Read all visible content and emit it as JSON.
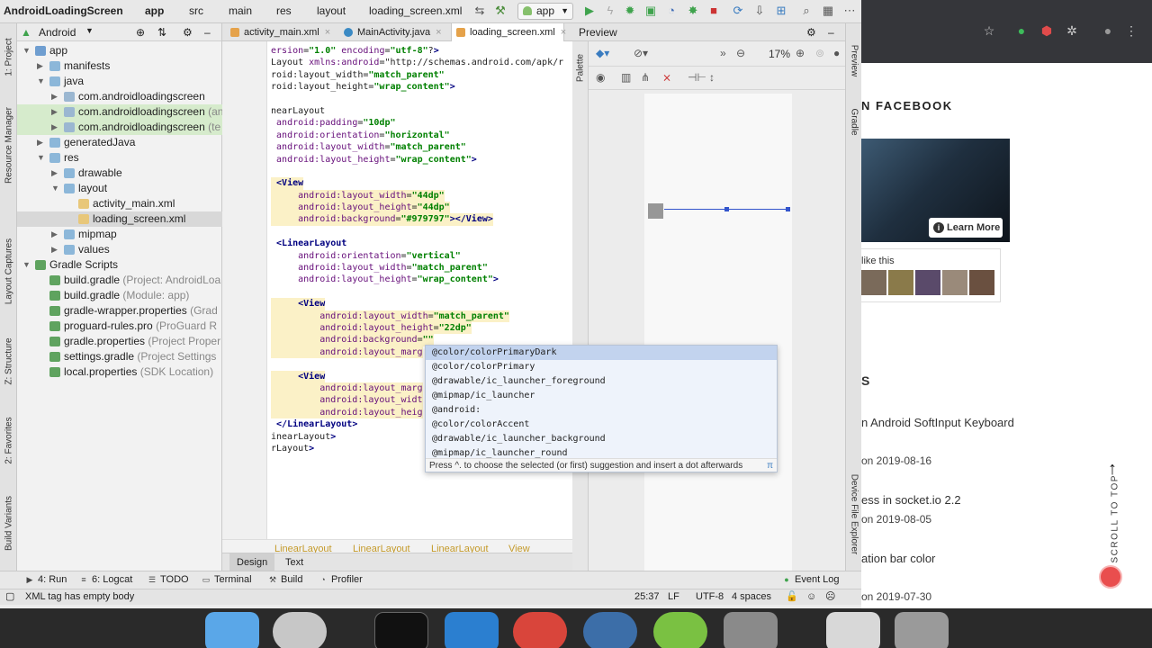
{
  "ide": {
    "breadcrumbs": [
      "AndroidLoadingScreen",
      "app",
      "src",
      "main",
      "res",
      "layout",
      "loading_screen.xml"
    ],
    "run_config": "app",
    "project_view": "Android",
    "editor_tabs": [
      {
        "label": "activity_main.xml",
        "active": false
      },
      {
        "label": "MainActivity.java",
        "active": false
      },
      {
        "label": "loading_screen.xml",
        "active": true
      }
    ],
    "left_strip": [
      "1: Project",
      "Resource Manager",
      "Layout Captures",
      "Z: Structure",
      "2: Favorites",
      "Build Variants"
    ],
    "right_strip": [
      "Preview",
      "Gradle",
      "Device File Explorer"
    ],
    "palette_label": "Palette",
    "tree": [
      {
        "label": "app",
        "extra": "",
        "icon": "module",
        "depth": 0,
        "expanded": true,
        "style": ""
      },
      {
        "label": "manifests",
        "extra": "",
        "icon": "folder",
        "depth": 1,
        "expanded": false,
        "style": ""
      },
      {
        "label": "java",
        "extra": "",
        "icon": "folder",
        "depth": 1,
        "expanded": true,
        "style": ""
      },
      {
        "label": "com.androidloadingscreen",
        "extra": "",
        "icon": "pkg",
        "depth": 2,
        "expanded": false,
        "style": ""
      },
      {
        "label": "com.androidloadingscreen",
        "extra": "(an",
        "icon": "pkg",
        "depth": 2,
        "expanded": false,
        "style": "green"
      },
      {
        "label": "com.androidloadingscreen",
        "extra": "(te",
        "icon": "pkg",
        "depth": 2,
        "expanded": false,
        "style": "green"
      },
      {
        "label": "generatedJava",
        "extra": "",
        "icon": "folder",
        "depth": 1,
        "expanded": false,
        "style": ""
      },
      {
        "label": "res",
        "extra": "",
        "icon": "folder",
        "depth": 1,
        "expanded": true,
        "style": ""
      },
      {
        "label": "drawable",
        "extra": "",
        "icon": "folder",
        "depth": 2,
        "expanded": false,
        "style": ""
      },
      {
        "label": "layout",
        "extra": "",
        "icon": "folder",
        "depth": 2,
        "expanded": true,
        "style": ""
      },
      {
        "label": "activity_main.xml",
        "extra": "",
        "icon": "file",
        "depth": 3,
        "expanded": null,
        "style": ""
      },
      {
        "label": "loading_screen.xml",
        "extra": "",
        "icon": "file",
        "depth": 3,
        "expanded": null,
        "style": "sel"
      },
      {
        "label": "mipmap",
        "extra": "",
        "icon": "folder",
        "depth": 2,
        "expanded": false,
        "style": ""
      },
      {
        "label": "values",
        "extra": "",
        "icon": "folder",
        "depth": 2,
        "expanded": false,
        "style": ""
      },
      {
        "label": "Gradle Scripts",
        "extra": "",
        "icon": "gradle",
        "depth": 0,
        "expanded": true,
        "style": ""
      },
      {
        "label": "build.gradle",
        "extra": "(Project: AndroidLoa",
        "icon": "gradle",
        "depth": 1,
        "expanded": null,
        "style": ""
      },
      {
        "label": "build.gradle",
        "extra": "(Module: app)",
        "icon": "gradle",
        "depth": 1,
        "expanded": null,
        "style": ""
      },
      {
        "label": "gradle-wrapper.properties",
        "extra": "(Grad",
        "icon": "gradle",
        "depth": 1,
        "expanded": null,
        "style": ""
      },
      {
        "label": "proguard-rules.pro",
        "extra": "(ProGuard R",
        "icon": "gradle",
        "depth": 1,
        "expanded": null,
        "style": ""
      },
      {
        "label": "gradle.properties",
        "extra": "(Project Proper",
        "icon": "gradle",
        "depth": 1,
        "expanded": null,
        "style": ""
      },
      {
        "label": "settings.gradle",
        "extra": "(Project Settings",
        "icon": "gradle",
        "depth": 1,
        "expanded": null,
        "style": ""
      },
      {
        "label": "local.properties",
        "extra": "(SDK Location)",
        "icon": "gradle",
        "depth": 1,
        "expanded": null,
        "style": ""
      }
    ],
    "code_lines": [
      {
        "n": "1",
        "t": "ersion=\"1.0\" encoding=\"utf-8\"?>",
        "hl": false
      },
      {
        "n": "2",
        "t": "Layout xmlns:android=\"http://schemas.android.com/apk/r",
        "hl": false
      },
      {
        "n": "3",
        "t": "roid:layout_width=\"match_parent\"",
        "hl": false
      },
      {
        "n": "4",
        "t": "roid:layout_height=\"wrap_content\">",
        "hl": false
      },
      {
        "n": "5",
        "t": "",
        "hl": false
      },
      {
        "n": "6",
        "t": "nearLayout",
        "hl": false
      },
      {
        "n": "7",
        "t": " android:padding=\"10dp\"",
        "hl": false
      },
      {
        "n": "8",
        "t": " android:orientation=\"horizontal\"",
        "hl": false
      },
      {
        "n": "9",
        "t": " android:layout_width=\"match_parent\"",
        "hl": false
      },
      {
        "n": "10",
        "t": " android:layout_height=\"wrap_content\">",
        "hl": false
      },
      {
        "n": "11",
        "t": "",
        "hl": false
      },
      {
        "n": "12",
        "t": " <View",
        "hl": true
      },
      {
        "n": "13",
        "t": "     android:layout_width=\"44dp\"",
        "hl": true
      },
      {
        "n": "14",
        "t": "     android:layout_height=\"44dp\"",
        "hl": true
      },
      {
        "n": "15",
        "t": "     android:background=\"#979797\"></View>",
        "hl": true
      },
      {
        "n": "16",
        "t": "",
        "hl": false
      },
      {
        "n": "17",
        "t": " <LinearLayout",
        "hl": false
      },
      {
        "n": "18",
        "t": "     android:orientation=\"vertical\"",
        "hl": false
      },
      {
        "n": "19",
        "t": "     android:layout_width=\"match_parent\"",
        "hl": false
      },
      {
        "n": "20",
        "t": "     android:layout_height=\"wrap_content\">",
        "hl": false
      },
      {
        "n": "21",
        "t": "",
        "hl": false
      },
      {
        "n": "22",
        "t": "     <View",
        "hl": true
      },
      {
        "n": "23",
        "t": "         android:layout_width=\"match_parent\"",
        "hl": true
      },
      {
        "n": "24",
        "t": "         android:layout_height=\"22dp\"",
        "hl": true
      },
      {
        "n": "25",
        "t": "         android:background=\"\"",
        "hl": true
      },
      {
        "n": "26",
        "t": "         android:layout_marg",
        "hl": true
      },
      {
        "n": "27",
        "t": "",
        "hl": false
      },
      {
        "n": "28",
        "t": "     <View",
        "hl": true
      },
      {
        "n": "29",
        "t": "         android:layout_marg",
        "hl": true
      },
      {
        "n": "30",
        "t": "         android:layout_widt",
        "hl": true
      },
      {
        "n": "31",
        "t": "         android:layout_heig",
        "hl": true
      },
      {
        "n": "32",
        "t": " </LinearLayout>",
        "hl": false
      },
      {
        "n": "33",
        "t": "inearLayout>",
        "hl": false
      },
      {
        "n": "34",
        "t": "rLayout>",
        "hl": false
      }
    ],
    "editor_breadcrumb": [
      "LinearLayout",
      "LinearLayout",
      "LinearLayout",
      "View"
    ],
    "design_tabs": [
      "Design",
      "Text"
    ],
    "autocomplete": {
      "items": [
        "@color/colorPrimaryDark",
        "@color/colorPrimary",
        "@drawable/ic_launcher_foreground",
        "@mipmap/ic_launcher",
        "@android:",
        "@color/colorAccent",
        "@drawable/ic_launcher_background",
        "@mipmap/ic_launcher_round"
      ],
      "hint": "Press ^. to choose the selected (or first) suggestion and insert a dot afterwards",
      "pi": "π"
    },
    "preview": {
      "title": "Preview",
      "zoom": "17%"
    },
    "bottom_tools": [
      "4: Run",
      "6: Logcat",
      "TODO",
      "Terminal",
      "Build",
      "Profiler",
      "Event Log"
    ],
    "status": {
      "message": "XML tag has empty body",
      "position": "25:37",
      "line_sep": "LF",
      "encoding": "UTF-8",
      "indent": "4 spaces"
    }
  },
  "browser": {
    "fb_title": "N FACEBOOK",
    "learn_more": "Learn More",
    "like_text": "like this",
    "partial_s": "S",
    "posts": [
      {
        "title": "n Android SoftInput Keyboard",
        "date": "on 2019-08-16"
      },
      {
        "title": "ess in socket.io 2.2",
        "date": "on 2019-08-05"
      },
      {
        "title": "ation bar color",
        "date": "on 2019-07-30"
      }
    ],
    "scroll_top": "SCROLL TO TOP"
  },
  "colors": {
    "accent_green": "#59a869",
    "selection_blue": "#3355cc",
    "highlight": "#fbf1c7",
    "red_button": "#e94e4e"
  }
}
